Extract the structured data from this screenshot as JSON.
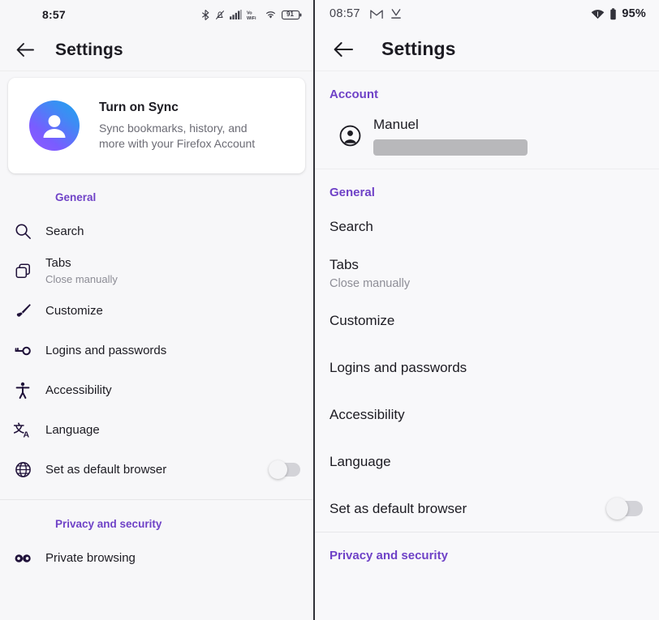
{
  "left_panel": {
    "status_bar": {
      "time": "8:57",
      "battery_level": "91",
      "icons": [
        "bluetooth-icon",
        "notifications-muted-icon",
        "cellular-signal-icon",
        "vowifi-icon",
        "wifi-icon",
        "battery-icon"
      ]
    },
    "toolbar": {
      "back_label": "back-arrow",
      "title": "Settings"
    },
    "sync_card": {
      "title": "Turn on Sync",
      "subtitle": "Sync bookmarks, history, and more with your Firefox Account",
      "avatar_gradient_from": "#9059ff",
      "avatar_gradient_to": "#1ea4f0"
    },
    "sections": [
      {
        "heading": "General",
        "heading_color": "#6f42c7",
        "items": [
          {
            "icon": "search-icon",
            "label": "Search",
            "sub": "",
            "toggle": false
          },
          {
            "icon": "tabs-icon",
            "label": "Tabs",
            "sub": "Close manually",
            "toggle": false
          },
          {
            "icon": "paintbrush-icon",
            "label": "Customize",
            "sub": "",
            "toggle": false
          },
          {
            "icon": "key-icon",
            "label": "Logins and passwords",
            "sub": "",
            "toggle": false
          },
          {
            "icon": "accessibility-icon",
            "label": "Accessibility",
            "sub": "",
            "toggle": false
          },
          {
            "icon": "translate-icon",
            "label": "Language",
            "sub": "",
            "toggle": false
          },
          {
            "icon": "globe-icon",
            "label": "Set as default browser",
            "sub": "",
            "toggle": true,
            "toggle_on": false
          }
        ]
      },
      {
        "heading": "Privacy and security",
        "heading_color": "#6f42c7",
        "items": [
          {
            "icon": "mask-icon",
            "label": "Private browsing",
            "sub": "",
            "toggle": false
          }
        ]
      }
    ]
  },
  "right_panel": {
    "status_bar": {
      "time": "08:57",
      "battery_percent": "95%",
      "icons": [
        "gmail-icon",
        "download-icon",
        "wifi-icon",
        "battery-icon"
      ]
    },
    "toolbar": {
      "back_label": "back-arrow",
      "title": "Settings"
    },
    "sections": [
      {
        "heading": "Account",
        "heading_color": "#6f42c7",
        "account": {
          "icon": "account-circle-icon",
          "name": "Manuel",
          "email_redacted": true
        }
      },
      {
        "heading": "General",
        "heading_color": "#6f42c7",
        "items": [
          {
            "label": "Search",
            "sub": "",
            "toggle": false
          },
          {
            "label": "Tabs",
            "sub": "Close manually",
            "toggle": false
          },
          {
            "label": "Customize",
            "sub": "",
            "toggle": false
          },
          {
            "label": "Logins and passwords",
            "sub": "",
            "toggle": false
          },
          {
            "label": "Accessibility",
            "sub": "",
            "toggle": false
          },
          {
            "label": "Language",
            "sub": "",
            "toggle": false
          },
          {
            "label": "Set as default browser",
            "sub": "",
            "toggle": true,
            "toggle_on": false
          }
        ]
      },
      {
        "heading": "Privacy and security",
        "heading_color": "#6f42c7",
        "items": []
      }
    ]
  }
}
